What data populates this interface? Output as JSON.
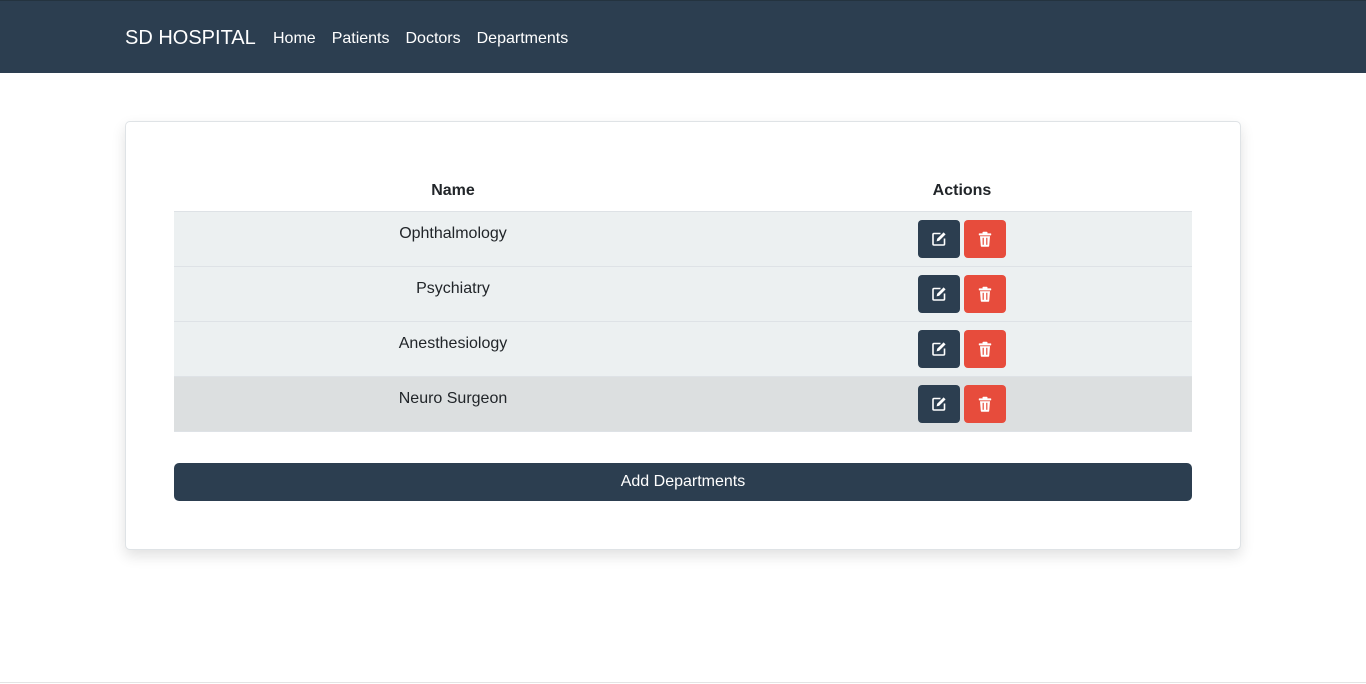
{
  "navbar": {
    "brand": "SD HOSPITAL",
    "links": [
      "Home",
      "Patients",
      "Doctors",
      "Departments"
    ]
  },
  "table": {
    "headers": {
      "name": "Name",
      "actions": "Actions"
    },
    "rows": [
      {
        "name": "Ophthalmology"
      },
      {
        "name": "Psychiatry"
      },
      {
        "name": "Anesthesiology"
      },
      {
        "name": "Neuro Surgeon"
      }
    ]
  },
  "add_button_label": "Add Departments",
  "icons": {
    "edit": "edit-icon",
    "delete": "trash-icon"
  },
  "colors": {
    "navbar": "#2c3e50",
    "primary": "#2c3e50",
    "danger": "#e74c3c",
    "row": "#ecf0f1",
    "row_hover": "#dcdfe0"
  }
}
